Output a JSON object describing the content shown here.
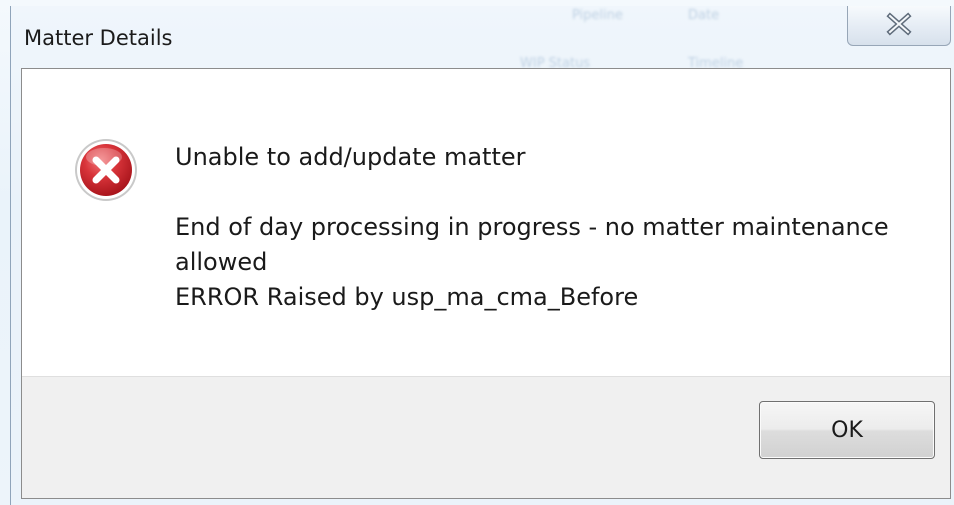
{
  "dialog": {
    "title": "Matter Details",
    "message": {
      "heading": "Unable to add/update matter",
      "line1": "End of day processing in progress - no matter maintenance",
      "line2": "allowed",
      "line3": "ERROR Raised by usp_ma_cma_Before"
    },
    "ok_label": "OK",
    "icon": "error-icon",
    "close_icon": "close-icon"
  },
  "background_app": {
    "texts": [
      "Pipeline",
      "Date",
      "WIP Status",
      "Timeline"
    ]
  },
  "colors": {
    "error_red": "#c8252c",
    "dialog_footer": "#f0f0f0",
    "dialog_body": "#ffffff"
  }
}
